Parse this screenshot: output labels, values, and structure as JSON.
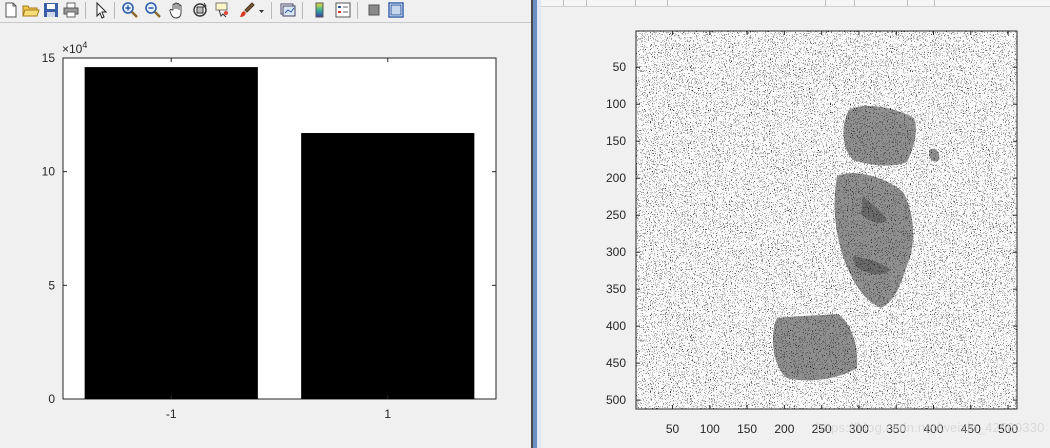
{
  "toolbar": {
    "icons": [
      "new-figure-icon",
      "open-file-icon",
      "save-icon",
      "print-icon",
      "select-arrow-icon",
      "zoom-in-icon",
      "zoom-out-icon",
      "pan-hand-icon",
      "rotate-3d-icon",
      "data-cursor-icon",
      "brush-icon",
      "link-plot-icon",
      "colorbar-icon",
      "legend-icon",
      "hide-plot-tools-icon",
      "show-plot-tools-icon"
    ]
  },
  "chart_data": [
    {
      "type": "bar",
      "categories": [
        "-1",
        "1"
      ],
      "values": [
        14.6,
        11.7
      ],
      "exponent_label": "×10",
      "exponent_power": "4",
      "ylim": [
        0,
        15
      ],
      "yticks": [
        "0",
        "5",
        "10",
        "15"
      ],
      "xlabel": "",
      "ylabel": "",
      "title": "",
      "bar_color": "#000000",
      "grid": false
    },
    {
      "type": "heatmap",
      "description_note": "",
      "xticks": [
        "50",
        "100",
        "150",
        "200",
        "250",
        "300",
        "350",
        "400",
        "450",
        "500"
      ],
      "yticks": [
        "50",
        "100",
        "150",
        "200",
        "250",
        "300",
        "350",
        "400",
        "450",
        "500"
      ],
      "xlim": [
        1,
        512
      ],
      "ylim": [
        1,
        512
      ],
      "colormap": "gray",
      "grid": false
    }
  ],
  "watermark": "https://blog.csdn.net/weixin_42580330"
}
